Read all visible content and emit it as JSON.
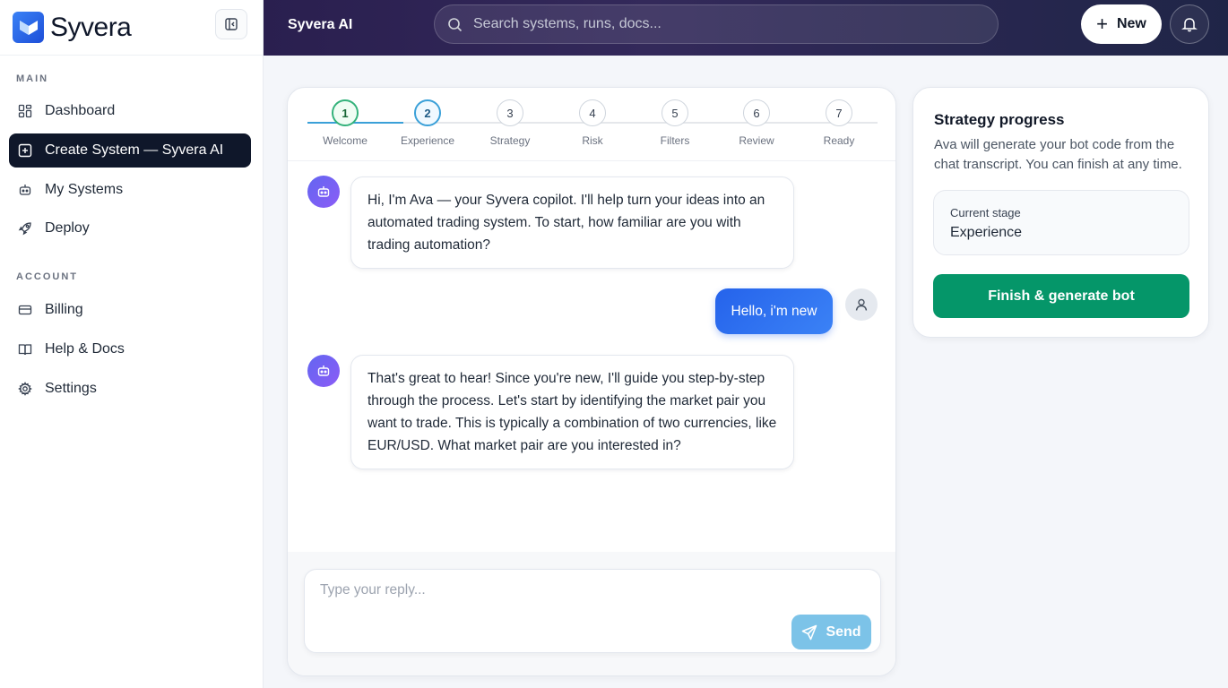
{
  "brand": {
    "name": "Syvera"
  },
  "sidebar": {
    "main_label": "MAIN",
    "account_label": "ACCOUNT",
    "items": [
      {
        "label": "Dashboard",
        "icon": "dashboard-grid-icon"
      },
      {
        "label": "Create System — Syvera AI",
        "icon": "plus-square-icon",
        "active": true
      },
      {
        "label": "My Systems",
        "icon": "robot-icon"
      },
      {
        "label": "Deploy",
        "icon": "rocket-icon"
      },
      {
        "label": "Billing",
        "icon": "credit-card-icon"
      },
      {
        "label": "Help & Docs",
        "icon": "book-icon"
      },
      {
        "label": "Settings",
        "icon": "gear-icon"
      }
    ]
  },
  "topbar": {
    "title": "Syvera AI",
    "search_placeholder": "Search systems, runs, docs...",
    "new_label": "New"
  },
  "stepper": {
    "steps": [
      {
        "num": "1",
        "label": "Welcome",
        "state": "done"
      },
      {
        "num": "2",
        "label": "Experience",
        "state": "current"
      },
      {
        "num": "3",
        "label": "Strategy",
        "state": "pending"
      },
      {
        "num": "4",
        "label": "Risk",
        "state": "pending"
      },
      {
        "num": "5",
        "label": "Filters",
        "state": "pending"
      },
      {
        "num": "6",
        "label": "Review",
        "state": "pending"
      },
      {
        "num": "7",
        "label": "Ready",
        "state": "pending"
      }
    ]
  },
  "chat": {
    "messages": [
      {
        "from": "bot",
        "text": "Hi, I'm Ava — your Syvera copilot. I'll help turn your ideas into an automated trading system. To start, how familiar are you with trading automation?"
      },
      {
        "from": "user",
        "text": "Hello, i'm new"
      },
      {
        "from": "bot",
        "text": "That's great to hear! Since you're new, I'll guide you step-by-step through the process. Let's start by identifying the market pair you want to trade. This is typically a combination of two currencies, like EUR/USD. What market pair are you interested in?"
      }
    ],
    "composer_placeholder": "Type your reply...",
    "send_label": "Send"
  },
  "progress": {
    "title": "Strategy progress",
    "description": "Ava will generate your bot code from the chat transcript. You can finish at any time.",
    "stage_label": "Current stage",
    "stage_value": "Experience",
    "finish_label": "Finish & generate bot"
  },
  "colors": {
    "accent": "#2563eb",
    "sidebar_active": "#0f172a",
    "finish_button": "#059669",
    "send_button": "#7cc3e8"
  }
}
